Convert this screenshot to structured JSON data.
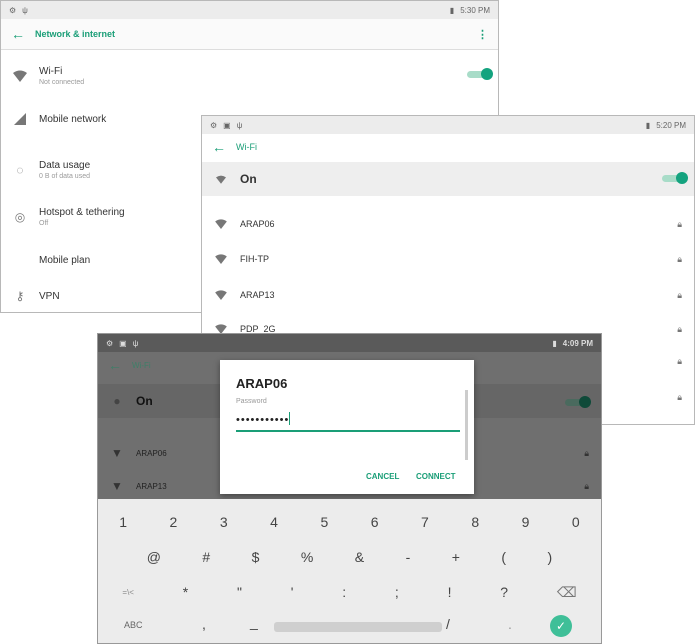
{
  "screen1": {
    "status_time": "5:30 PM",
    "title": "Network & internet",
    "items": [
      {
        "title": "Wi-Fi",
        "subtitle": "Not connected",
        "icon": "wifi-icon"
      },
      {
        "title": "Mobile network",
        "subtitle": "",
        "icon": "signal-icon"
      },
      {
        "title": "Data usage",
        "subtitle": "0 B of data used",
        "icon": "data-usage-icon"
      },
      {
        "title": "Hotspot & tethering",
        "subtitle": "Off",
        "icon": "hotspot-icon"
      },
      {
        "title": "Mobile plan",
        "subtitle": "",
        "icon": ""
      },
      {
        "title": "VPN",
        "subtitle": "",
        "icon": "vpn-key-icon"
      }
    ]
  },
  "screen2": {
    "status_time": "5:20 PM",
    "title": "Wi-Fi",
    "on_label": "On",
    "networks": [
      "ARAP06",
      "FIH-TP",
      "ARAP13",
      "PDP_2G"
    ]
  },
  "screen3": {
    "status_time": "4:09 PM",
    "title": "Wi-Fi",
    "on_label": "On",
    "networks": [
      "ARAP06",
      "ARAP13"
    ],
    "dialog": {
      "title": "ARAP06",
      "password_label": "Password",
      "password_value": "•••••••••••",
      "cancel": "CANCEL",
      "connect": "CONNECT"
    },
    "keyboard": {
      "row1": [
        "1",
        "2",
        "3",
        "4",
        "5",
        "6",
        "7",
        "8",
        "9",
        "0"
      ],
      "row2": [
        "@",
        "#",
        "$",
        "%",
        "&",
        "-",
        "+",
        "(",
        ")"
      ],
      "row3": [
        "=\\<",
        "*",
        "\"",
        "'",
        ":",
        ";",
        "!",
        "?"
      ],
      "row4": [
        "ABC",
        ",",
        "_",
        "/",
        "."
      ]
    }
  },
  "colors": {
    "accent": "#1a9e77",
    "toggle": "#14a37f",
    "scrim": "#6f6f6f"
  }
}
